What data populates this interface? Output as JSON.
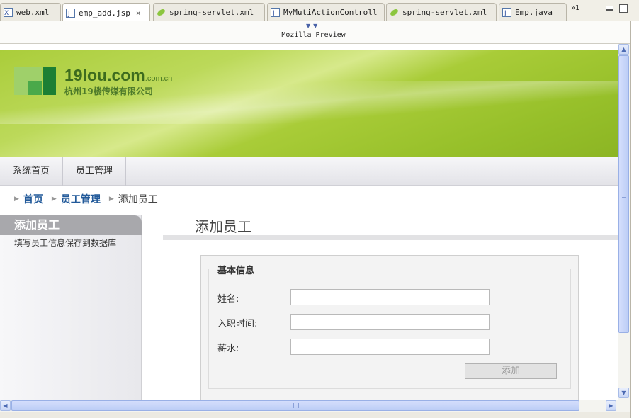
{
  "editor": {
    "tabs": [
      {
        "label": "web.xml",
        "icon": "xml-file-icon",
        "active": false
      },
      {
        "label": "emp_add.jsp",
        "icon": "jsp-file-icon",
        "active": true,
        "close": "×"
      },
      {
        "label": "spring-servlet.xml",
        "icon": "spring-leaf-icon",
        "active": false
      },
      {
        "label": "MyMutiActionControll",
        "icon": "java-file-icon",
        "active": false
      },
      {
        "label": "spring-servlet.xml",
        "icon": "spring-leaf-icon",
        "active": false
      },
      {
        "label": "Emp.java",
        "icon": "java-file-icon",
        "active": false
      }
    ],
    "overflow_label": "»1",
    "preview_title": "Mozilla Preview"
  },
  "site": {
    "logo_name": "19lou.com",
    "logo_suffix": ".com.cn",
    "logo_sub": "杭州19楼传媒有限公司",
    "nav": [
      "系统首页",
      "员工管理"
    ],
    "breadcrumbs": [
      "首页",
      "员工管理",
      "添加员工"
    ],
    "sidebar_title": "添加员工",
    "sidebar_desc": "填写员工信息保存到数据库",
    "page_title": "添加员工",
    "form": {
      "legend": "基本信息",
      "fields": [
        {
          "label": "姓名:",
          "value": ""
        },
        {
          "label": "入职时间:",
          "value": ""
        },
        {
          "label": "薪水:",
          "value": ""
        }
      ],
      "submit_label": "添加"
    }
  },
  "colors": {
    "banner_green": "#9cc430",
    "link_blue": "#225a9a",
    "scrollbar_blue": "#bccdf6"
  }
}
